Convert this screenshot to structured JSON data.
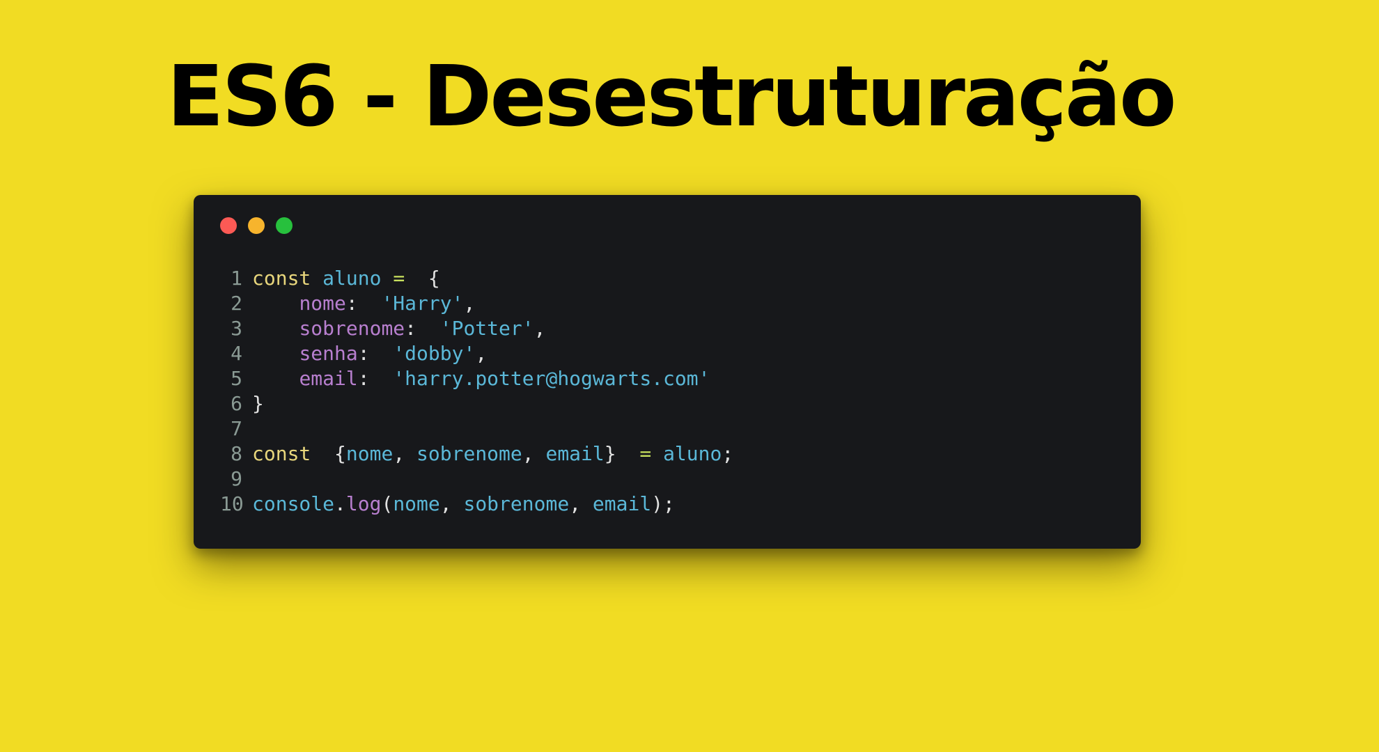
{
  "title": "ES6 - Desestruturação",
  "window": {
    "controls": [
      {
        "name": "close",
        "color": "#fc5a55"
      },
      {
        "name": "minimize",
        "color": "#f7b42d"
      },
      {
        "name": "maximize",
        "color": "#27c03d"
      }
    ]
  },
  "colors": {
    "background": "#f1dc23",
    "editor_background": "#17181b",
    "keyword": "#e8d67c",
    "variable": "#5bb8d8",
    "property": "#b87fcf",
    "string": "#5bb8d8",
    "operator": "#c8e05e",
    "punctuation": "#e2e2e2",
    "line_number": "#8a9a94"
  },
  "code": {
    "lines": [
      {
        "number": "1",
        "tokens": [
          {
            "t": "const",
            "c": "keyword"
          },
          {
            "t": " ",
            "c": "punctuation"
          },
          {
            "t": "aluno",
            "c": "variable"
          },
          {
            "t": " ",
            "c": "punctuation"
          },
          {
            "t": "=",
            "c": "operator"
          },
          {
            "t": "  {",
            "c": "punctuation"
          }
        ]
      },
      {
        "number": "2",
        "tokens": [
          {
            "t": "    ",
            "c": "punctuation"
          },
          {
            "t": "nome",
            "c": "property"
          },
          {
            "t": ":  ",
            "c": "punctuation"
          },
          {
            "t": "'Harry'",
            "c": "string"
          },
          {
            "t": ",",
            "c": "punctuation"
          }
        ]
      },
      {
        "number": "3",
        "tokens": [
          {
            "t": "    ",
            "c": "punctuation"
          },
          {
            "t": "sobrenome",
            "c": "property"
          },
          {
            "t": ":  ",
            "c": "punctuation"
          },
          {
            "t": "'Potter'",
            "c": "string"
          },
          {
            "t": ",",
            "c": "punctuation"
          }
        ]
      },
      {
        "number": "4",
        "tokens": [
          {
            "t": "    ",
            "c": "punctuation"
          },
          {
            "t": "senha",
            "c": "property"
          },
          {
            "t": ":  ",
            "c": "punctuation"
          },
          {
            "t": "'dobby'",
            "c": "string"
          },
          {
            "t": ",",
            "c": "punctuation"
          }
        ]
      },
      {
        "number": "5",
        "tokens": [
          {
            "t": "    ",
            "c": "punctuation"
          },
          {
            "t": "email",
            "c": "property"
          },
          {
            "t": ":  ",
            "c": "punctuation"
          },
          {
            "t": "'harry.potter@hogwarts.com'",
            "c": "string"
          }
        ]
      },
      {
        "number": "6",
        "tokens": [
          {
            "t": "}",
            "c": "punctuation"
          }
        ]
      },
      {
        "number": "7",
        "tokens": []
      },
      {
        "number": "8",
        "tokens": [
          {
            "t": "const",
            "c": "keyword"
          },
          {
            "t": "  {",
            "c": "punctuation"
          },
          {
            "t": "nome",
            "c": "variable"
          },
          {
            "t": ", ",
            "c": "punctuation"
          },
          {
            "t": "sobrenome",
            "c": "variable"
          },
          {
            "t": ", ",
            "c": "punctuation"
          },
          {
            "t": "email",
            "c": "variable"
          },
          {
            "t": "}  ",
            "c": "punctuation"
          },
          {
            "t": "=",
            "c": "operator"
          },
          {
            "t": " ",
            "c": "punctuation"
          },
          {
            "t": "aluno",
            "c": "variable"
          },
          {
            "t": ";",
            "c": "punctuation"
          }
        ]
      },
      {
        "number": "9",
        "tokens": []
      },
      {
        "number": "10",
        "tokens": [
          {
            "t": "console",
            "c": "variable"
          },
          {
            "t": ".",
            "c": "punctuation"
          },
          {
            "t": "log",
            "c": "property"
          },
          {
            "t": "(",
            "c": "punctuation"
          },
          {
            "t": "nome",
            "c": "variable"
          },
          {
            "t": ", ",
            "c": "punctuation"
          },
          {
            "t": "sobrenome",
            "c": "variable"
          },
          {
            "t": ", ",
            "c": "punctuation"
          },
          {
            "t": "email",
            "c": "variable"
          },
          {
            "t": ");",
            "c": "punctuation"
          }
        ]
      }
    ]
  }
}
